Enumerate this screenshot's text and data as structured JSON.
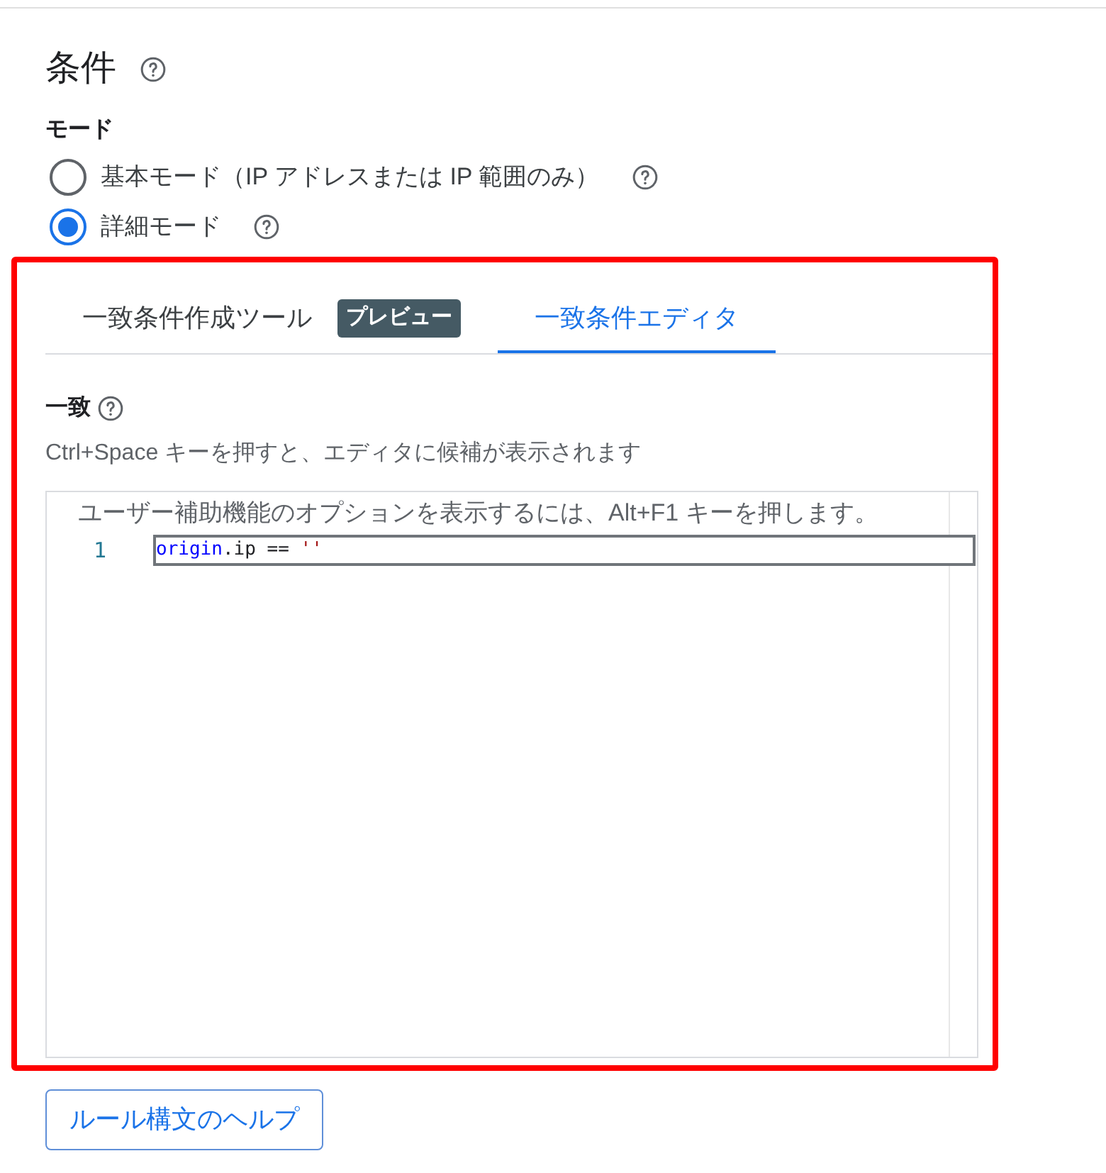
{
  "section": {
    "title": "条件"
  },
  "mode": {
    "label": "モード",
    "options": [
      {
        "label": "基本モード（IP アドレスまたは IP 範囲のみ）",
        "selected": false
      },
      {
        "label": "詳細モード",
        "selected": true
      }
    ]
  },
  "tabs": [
    {
      "label": "一致条件作成ツール",
      "badge": "プレビュー",
      "selected": false
    },
    {
      "label": "一致条件エディタ",
      "selected": true
    }
  ],
  "match": {
    "label": "一致",
    "hint": "Ctrl+Space キーを押すと、エディタに候補が表示されます"
  },
  "editor": {
    "accessibility_hint": "ユーザー補助機能のオプションを表示するには、Alt+F1 キーを押します。",
    "lines": [
      {
        "number": "1",
        "tokens": [
          {
            "text": "origin",
            "kind": "keyword"
          },
          {
            "text": ".ip == ",
            "kind": "plain"
          },
          {
            "text": "''",
            "kind": "string"
          }
        ]
      }
    ]
  },
  "help_button": "ルール構文のヘルプ"
}
